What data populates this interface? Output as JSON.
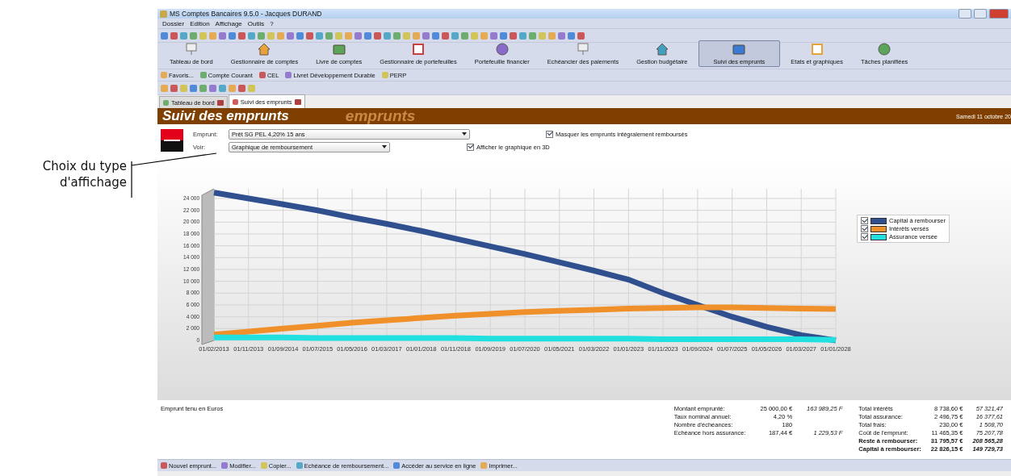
{
  "annotation": {
    "text": "Choix du type d'affichage"
  },
  "window": {
    "title": "MS Comptes Bancaires 9.5.0  - Jacques DURAND"
  },
  "menu": [
    "Dossier",
    "Edition",
    "Affichage",
    "Outils",
    "?"
  ],
  "modules": [
    {
      "label": "Tableau de bord",
      "selected": false
    },
    {
      "label": "Gestionnaire de comptes",
      "selected": false
    },
    {
      "label": "Livre de comptes",
      "selected": false
    },
    {
      "label": "Gestionnaire de portefeuilles",
      "selected": false
    },
    {
      "label": "Portefeuille financier",
      "selected": false
    },
    {
      "label": "Echéancier des paiements",
      "selected": false
    },
    {
      "label": "Gestion budgétaire",
      "selected": false
    },
    {
      "label": "Suivi des emprunts",
      "selected": true
    },
    {
      "label": "Etats et graphiques",
      "selected": false
    },
    {
      "label": "Tâches planifiées",
      "selected": false
    }
  ],
  "favorites": [
    "Favoris...",
    "Compte Courant",
    "CEL",
    "Livret Développement Durable",
    "PERP"
  ],
  "tabs": [
    {
      "label": "Tableau de bord",
      "selected": false
    },
    {
      "label": "Suivi des emprunts",
      "selected": true
    }
  ],
  "header": {
    "title": "Suivi des emprunts",
    "backdrop_text": "emprunts",
    "date": "Samedi 11 octobre 20"
  },
  "controls": {
    "loan_label": "Emprunt:",
    "loan_value": "Prêt SG PEL 4,20% 15 ans",
    "view_label": "Voir:",
    "view_value": "Graphique de remboursement",
    "options": [
      {
        "label": "Masquer les emprunts intégralement remboursés",
        "checked": true
      },
      {
        "label": "Afficher le graphique en 3D",
        "checked": true
      }
    ]
  },
  "chart": {
    "chart_data": {
      "type": "line",
      "categories": [
        "01/02/2013",
        "01/11/2013",
        "01/09/2014",
        "01/07/2015",
        "01/05/2016",
        "01/03/2017",
        "01/01/2018",
        "01/11/2018",
        "01/09/2019",
        "01/07/2020",
        "01/05/2021",
        "01/03/2022",
        "01/01/2023",
        "01/11/2023",
        "01/09/2024",
        "01/07/2025",
        "01/05/2026",
        "01/03/2027",
        "01/01/2028"
      ],
      "ylim": [
        0,
        26000
      ],
      "grid": true,
      "legend": true,
      "yticks": [
        {
          "value": 0,
          "label": "0"
        },
        {
          "value": 2000,
          "label": "2 000"
        },
        {
          "value": 4000,
          "label": "4 000"
        },
        {
          "value": 6000,
          "label": "6 000"
        },
        {
          "value": 8000,
          "label": "8 000"
        },
        {
          "value": 10000,
          "label": "10 000"
        },
        {
          "value": 12000,
          "label": "12 000"
        },
        {
          "value": 14000,
          "label": "14 000"
        },
        {
          "value": 16000,
          "label": "16 000"
        },
        {
          "value": 18000,
          "label": "18 000"
        },
        {
          "value": 20000,
          "label": "20 000"
        },
        {
          "value": 22000,
          "label": "22 000"
        },
        {
          "value": 24000,
          "label": "24 000"
        }
      ],
      "series": [
        {
          "name": "Capital à rembourser",
          "color": "#2f4f8f",
          "values": [
            25000,
            24000,
            23000,
            22000,
            20800,
            19700,
            18500,
            17200,
            15900,
            14600,
            13200,
            11800,
            10300,
            8000,
            6000,
            4000,
            2300,
            900,
            0
          ]
        },
        {
          "name": "Intérêts versés",
          "color": "#f0902a",
          "values": [
            1000,
            1500,
            2000,
            2500,
            3000,
            3400,
            3800,
            4200,
            4500,
            4800,
            5000,
            5200,
            5400,
            5500,
            5600,
            5600,
            5500,
            5400,
            5300
          ]
        },
        {
          "name": "Assurance versée",
          "color": "#22e0e0",
          "values": [
            500,
            500,
            500,
            400,
            400,
            400,
            400,
            400,
            300,
            300,
            300,
            300,
            300,
            200,
            200,
            200,
            200,
            200,
            100
          ]
        }
      ]
    },
    "legend_checked": [
      true,
      true,
      true
    ]
  },
  "currency_note": "Emprunt tenu en  Euros",
  "stats_left": [
    {
      "label": "Montant emprunté:",
      "value": "25 000,00 €",
      "franc": "163 989,25 F",
      "bold": false
    },
    {
      "label": "Taux nominal annuel:",
      "value": "4,20 %",
      "bold": false
    },
    {
      "label": "Nombre d'échéances:",
      "value": "180",
      "bold": false
    },
    {
      "label": "Echéance hors assurance:",
      "value": "187,44 €",
      "franc": "1 229,53 F",
      "bold": false
    }
  ],
  "stats_right": [
    {
      "label": "Total intérêts",
      "value": "8 738,60 €",
      "franc": "57 321,47",
      "bold": false
    },
    {
      "label": "Total assurance:",
      "value": "2 496,75 €",
      "franc": "16 377,61",
      "bold": false
    },
    {
      "label": "Total frais:",
      "value": "230,00 €",
      "franc": "1 508,70",
      "bold": false
    },
    {
      "label": "Coût de l'emprunt:",
      "value": "11 465,35 €",
      "franc": "75 207,78",
      "bold": false
    },
    {
      "label": "Reste à rembourser:",
      "value": "31 795,57 €",
      "franc": "208 565,28",
      "bold": true
    },
    {
      "label": "Capital à rembourser:",
      "value": "22 826,15 €",
      "franc": "149 729,73",
      "bold": true
    }
  ],
  "actions": [
    "Nouvel emprunt...",
    "Modifier...",
    "Copier...",
    "Echéance de remboursement...",
    "Accéder au service en ligne",
    "Imprimer..."
  ]
}
